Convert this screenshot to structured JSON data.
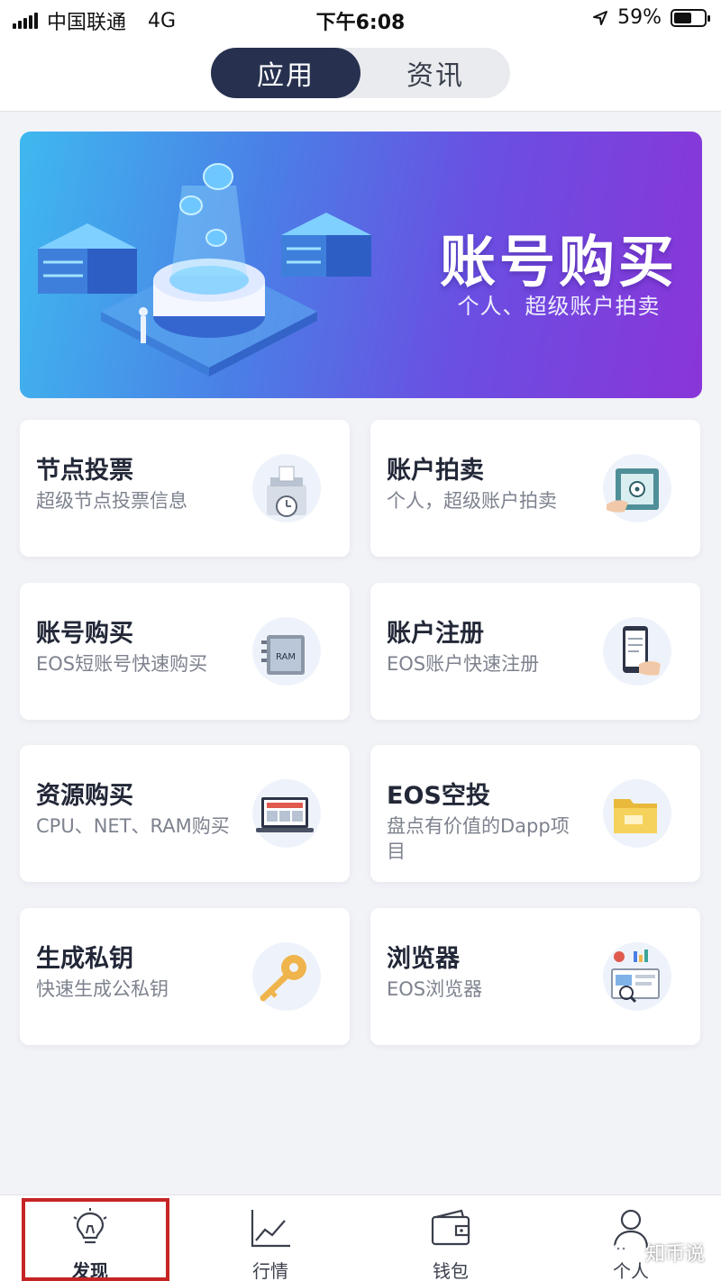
{
  "status_bar": {
    "carrier": "中国联通",
    "network": "4G",
    "time": "下午6:08",
    "battery": "59%",
    "battery_level": 0.59
  },
  "tabs": [
    {
      "label": "应用",
      "active": true
    },
    {
      "label": "资讯",
      "active": false
    }
  ],
  "banner": {
    "title": "账号购买",
    "subtitle": "个人、超级账户拍卖"
  },
  "cards": [
    {
      "title": "节点投票",
      "subtitle": "超级节点投票信息",
      "icon": "ballot-box-icon"
    },
    {
      "title": "账户拍卖",
      "subtitle": "个人，超级账户拍卖",
      "icon": "safe-box-icon"
    },
    {
      "title": "账号购买",
      "subtitle": "EOS短账号快速购买",
      "icon": "ram-chip-icon"
    },
    {
      "title": "账户注册",
      "subtitle": "EOS账户快速注册",
      "icon": "phone-register-icon"
    },
    {
      "title": "资源购买",
      "subtitle": "CPU、NET、RAM购买",
      "icon": "laptop-icon"
    },
    {
      "title": "EOS空投",
      "subtitle": "盘点有价值的Dapp项目",
      "icon": "folder-icon"
    },
    {
      "title": "生成私钥",
      "subtitle": "快速生成公私钥",
      "icon": "key-icon"
    },
    {
      "title": "浏览器",
      "subtitle": "EOS浏览器",
      "icon": "browser-dashboard-icon"
    }
  ],
  "ram_chip_label": "RAM",
  "tabbar": [
    {
      "label": "发现",
      "icon": "lightbulb-icon",
      "active": true
    },
    {
      "label": "行情",
      "icon": "chart-icon",
      "active": false
    },
    {
      "label": "钱包",
      "icon": "wallet-icon",
      "active": false
    },
    {
      "label": "个人",
      "icon": "person-icon",
      "active": false
    }
  ],
  "watermark": "知币说"
}
